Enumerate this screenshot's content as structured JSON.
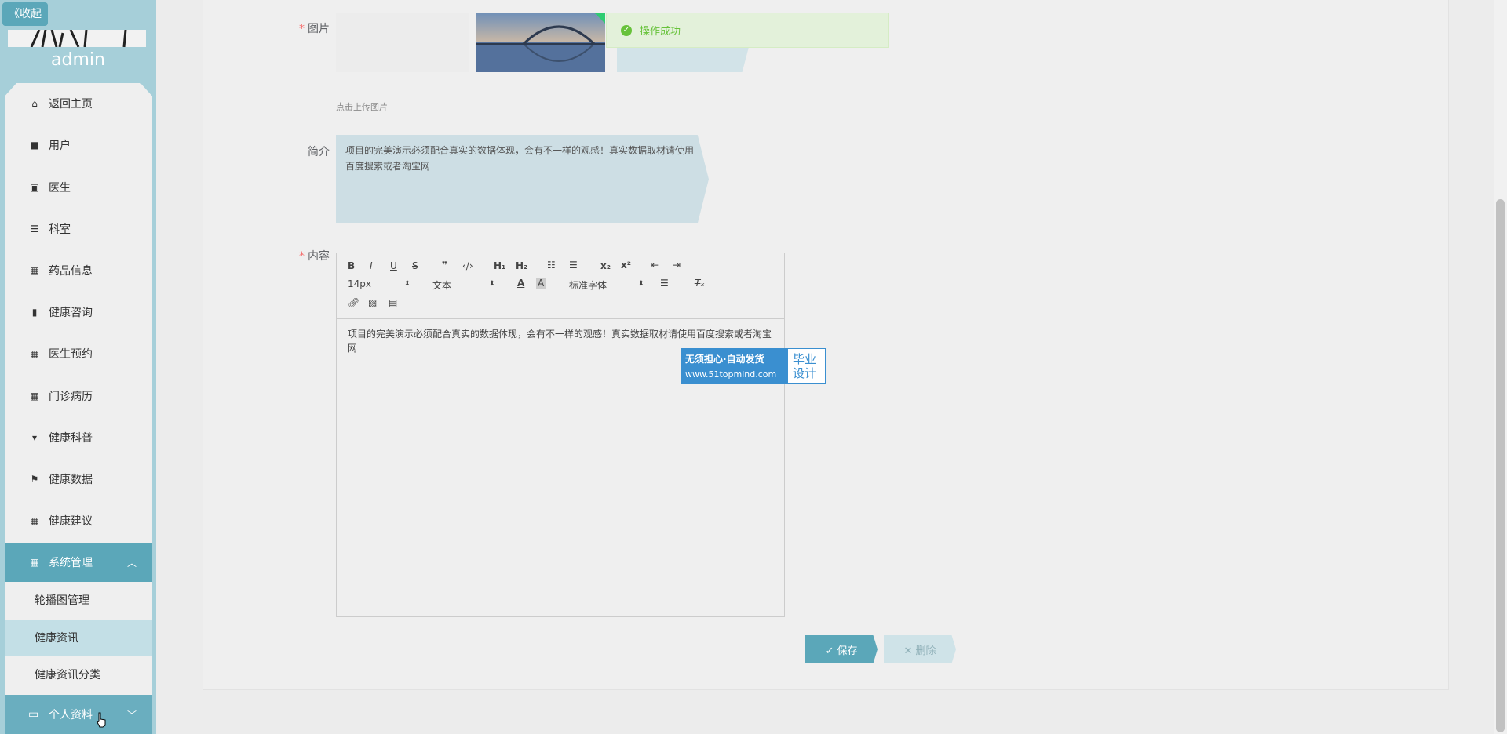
{
  "sidebar": {
    "collapse_label": "《收起",
    "username": "admin",
    "items": [
      {
        "label": "返回主页",
        "icon": "home-icon"
      },
      {
        "label": "用户",
        "icon": "user-icon"
      },
      {
        "label": "医生",
        "icon": "doctor-icon"
      },
      {
        "label": "科室",
        "icon": "list-icon"
      },
      {
        "label": "药品信息",
        "icon": "grid-icon"
      },
      {
        "label": "健康咨询",
        "icon": "chart-icon"
      },
      {
        "label": "医生预约",
        "icon": "grid-icon"
      },
      {
        "label": "门诊病历",
        "icon": "grid-icon"
      },
      {
        "label": "健康科普",
        "icon": "pin-icon"
      },
      {
        "label": "健康数据",
        "icon": "flag-icon"
      },
      {
        "label": "健康建议",
        "icon": "grid-icon"
      }
    ],
    "system": {
      "label": "系统管理",
      "sub_items": [
        "轮播图管理",
        "健康资讯",
        "健康资讯分类"
      ]
    },
    "profile_label": "个人资料"
  },
  "form": {
    "image_label": "图片",
    "upload_hint": "点击上传图片",
    "intro_label": "简介",
    "intro_value": "项目的完美演示必须配合真实的数据体现，会有不一样的观感！真实数据取材请使用百度搜索或者淘宝网",
    "content_label": "内容",
    "content_value": "项目的完美演示必须配合真实的数据体现，会有不一样的观感！真实数据取材请使用百度搜索或者淘宝网"
  },
  "editor": {
    "font_size": "14px",
    "header_select": "文本",
    "font_family": "标准字体"
  },
  "toast": {
    "message": "操作成功",
    "color": "#67c23a"
  },
  "watermark": {
    "line1": "无须担心·自动发货",
    "url": "www.51topmind.com",
    "right": "毕业设计"
  },
  "buttons": {
    "save": "✓ 保存",
    "delete": "✕ 删除"
  },
  "colors": {
    "accent": "#5ba7b9",
    "sidebar_bg": "#a6cfd9"
  }
}
